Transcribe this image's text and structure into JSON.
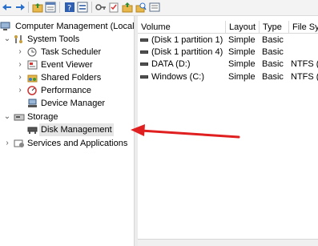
{
  "toolbar": {
    "icons": [
      "back-icon",
      "forward-icon",
      "up-folder-icon",
      "properties-icon",
      "help-icon",
      "view-icon",
      "key-icon",
      "check-icon",
      "folder-up-icon",
      "search-folder-icon",
      "list-icon"
    ]
  },
  "tree": {
    "root": "Computer Management (Local",
    "system_tools": "System Tools",
    "task_scheduler": "Task Scheduler",
    "event_viewer": "Event Viewer",
    "shared_folders": "Shared Folders",
    "performance": "Performance",
    "device_manager": "Device Manager",
    "storage": "Storage",
    "disk_management": "Disk Management",
    "services": "Services and Applications"
  },
  "list": {
    "headers": {
      "volume": "Volume",
      "layout": "Layout",
      "type": "Type",
      "fs": "File Sys"
    },
    "rows": [
      {
        "volume": "(Disk 1 partition 1)",
        "layout": "Simple",
        "type": "Basic",
        "fs": ""
      },
      {
        "volume": "(Disk 1 partition 4)",
        "layout": "Simple",
        "type": "Basic",
        "fs": ""
      },
      {
        "volume": "DATA (D:)",
        "layout": "Simple",
        "type": "Basic",
        "fs": "NTFS (B"
      },
      {
        "volume": "Windows (C:)",
        "layout": "Simple",
        "type": "Basic",
        "fs": "NTFS (B"
      }
    ]
  },
  "colors": {
    "arrow": "#e02020",
    "selection": "#e6e6e6"
  }
}
